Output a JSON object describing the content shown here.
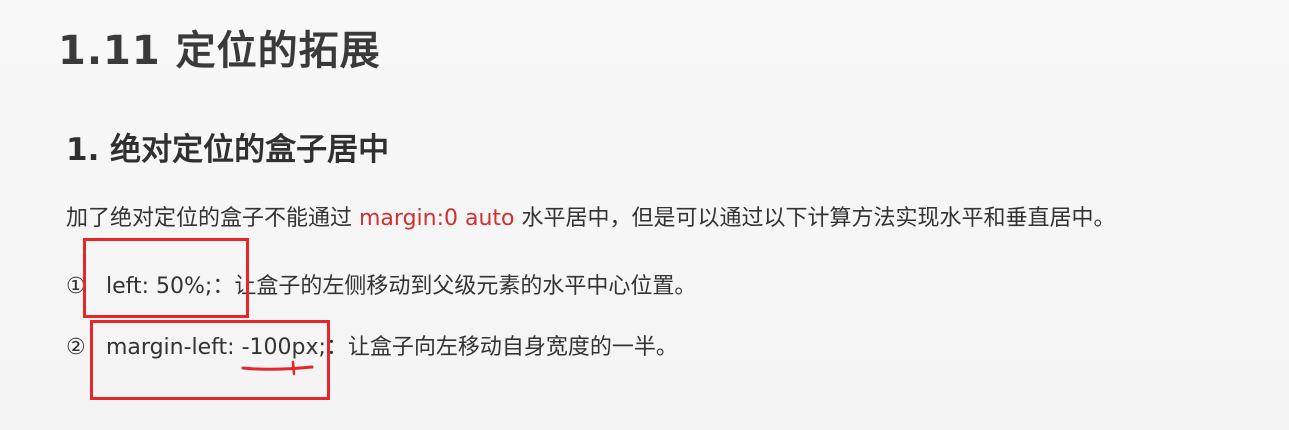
{
  "main_title": "1.11 定位的拓展",
  "section_title": "1. 绝对定位的盒子居中",
  "intro": {
    "before": "加了绝对定位的盒子不能通过 ",
    "code": "margin:0 auto",
    "after": " 水平居中，但是可以通过以下计算方法实现水平和垂直居中。"
  },
  "items": [
    {
      "marker": "①",
      "code": "left: 50%;",
      "description": "：让盒子的左侧移动到父级元素的水平中心位置。"
    },
    {
      "marker": "②",
      "code": "margin-left: -100px;",
      "description": "：让盒子向左移动自身宽度的一半。"
    }
  ],
  "colors": {
    "highlight": "#e8252a",
    "code_accent": "#d32f2f"
  }
}
